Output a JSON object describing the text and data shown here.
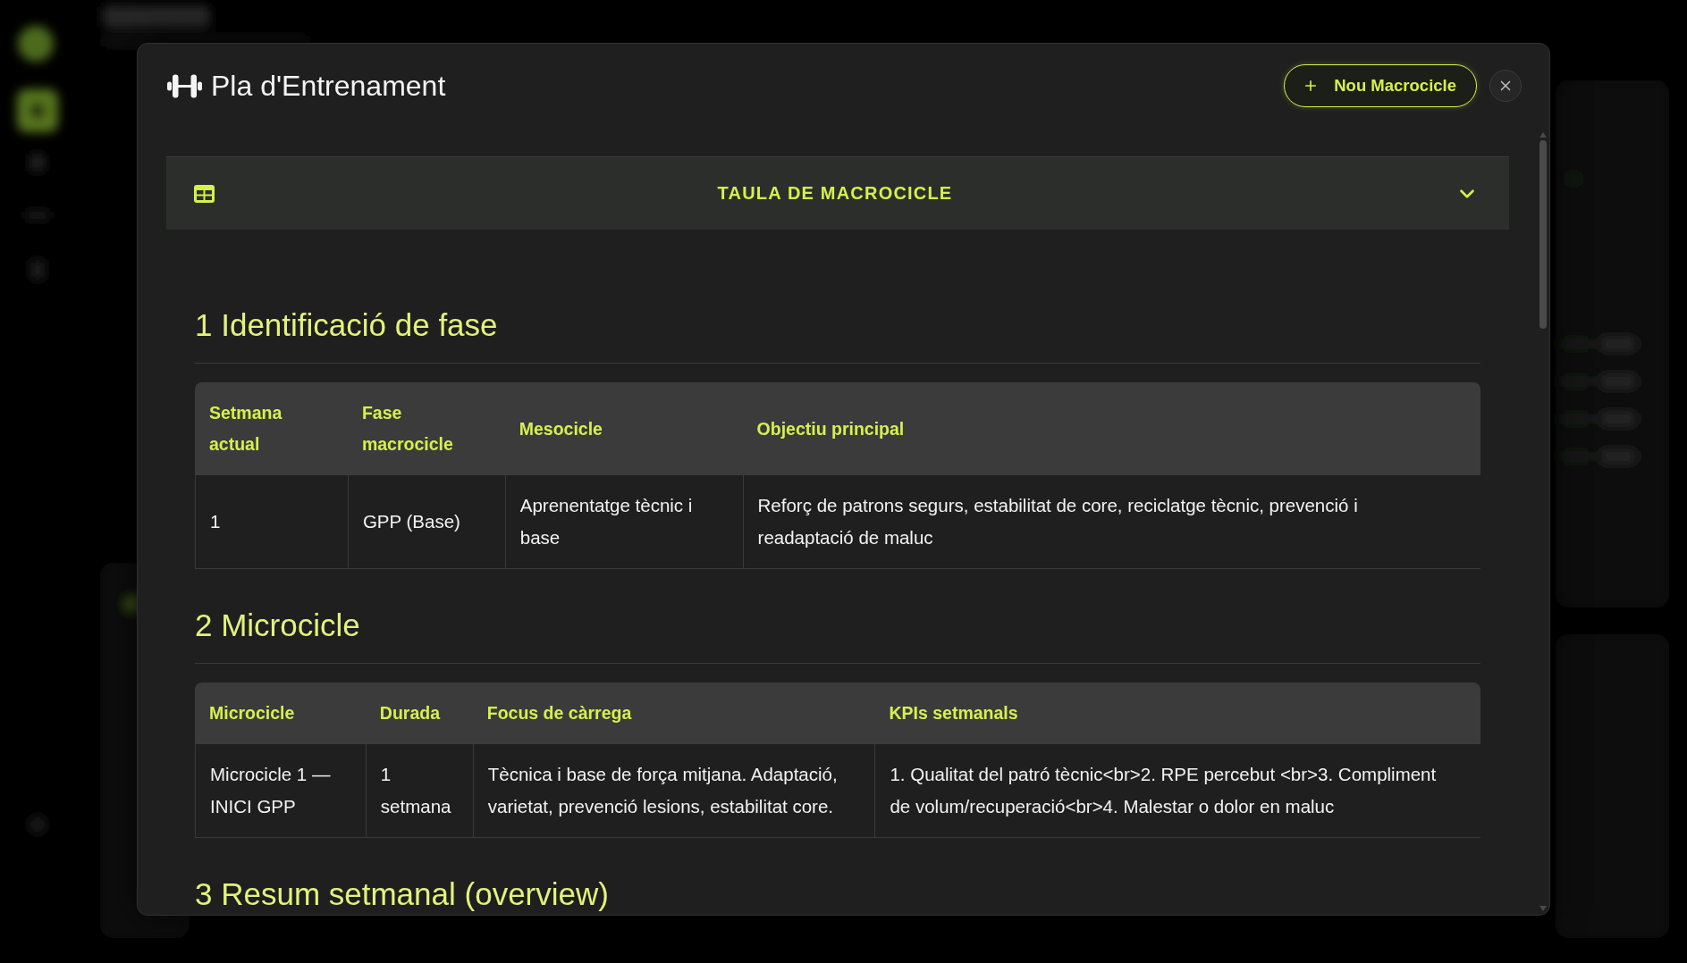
{
  "window": {
    "title": "Pla d'Entrenament"
  },
  "actions": {
    "new_button": "Nou Macrocicle"
  },
  "accordion": {
    "title": "TAULA DE MACROCICLE",
    "expanded": true
  },
  "sections": [
    {
      "heading": "1 Identificació de fase",
      "table": {
        "columns": [
          "Setmana actual",
          "Fase macrocicle",
          "Mesocicle",
          "Objectiu principal"
        ],
        "rows": [
          [
            "1",
            "GPP (Base)",
            "Aprenentatge tècnic i base",
            "Reforç de patrons segurs, estabilitat de core, reciclatge tècnic, prevenció i readaptació de maluc"
          ]
        ]
      }
    },
    {
      "heading": "2 Microcicle",
      "table": {
        "columns": [
          "Microcicle",
          "Durada",
          "Focus de càrrega",
          "KPIs setmanals"
        ],
        "rows": [
          [
            "Microcicle 1 — INICI GPP",
            "1 setmana",
            "Tècnica i base de força mitjana. Adaptació, varietat, prevenció lesions, estabilitat core.",
            "1. Qualitat del patró tècnic<br>2. RPE percebut <br>3. Compliment de volum/recuperació<br>4. Malestar o dolor en maluc"
          ]
        ]
      }
    },
    {
      "heading": "3 Resum setmanal (overview)"
    }
  ]
}
